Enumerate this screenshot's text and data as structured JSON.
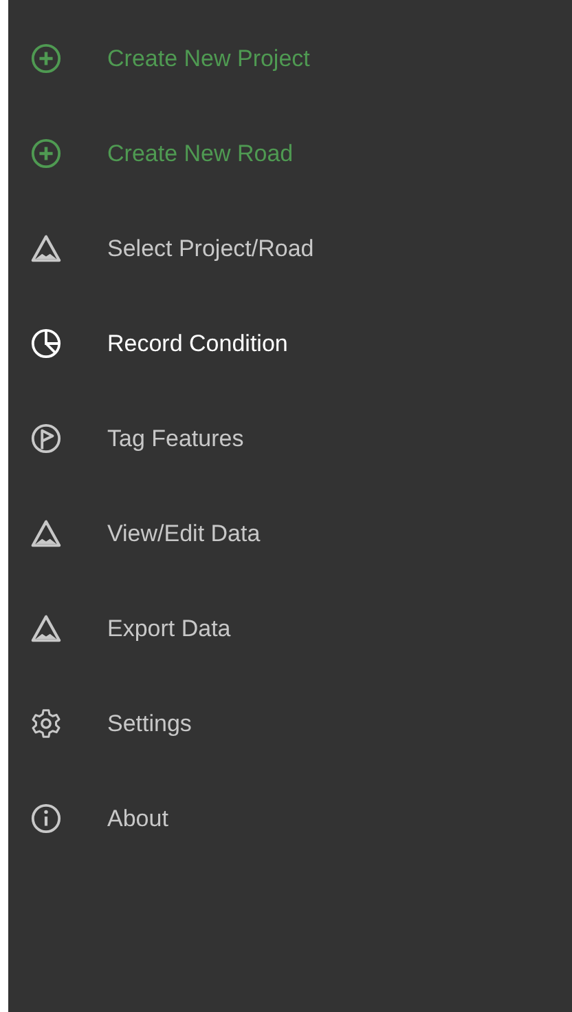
{
  "menu": {
    "items": [
      {
        "label": "Create New Project",
        "kind": "create",
        "selected": false
      },
      {
        "label": "Create New Road",
        "kind": "create",
        "selected": false
      },
      {
        "label": "Select Project/Road",
        "kind": "nav",
        "selected": false
      },
      {
        "label": "Record Condition",
        "kind": "nav",
        "selected": true
      },
      {
        "label": "Tag Features",
        "kind": "nav",
        "selected": false
      },
      {
        "label": "View/Edit Data",
        "kind": "nav",
        "selected": false
      },
      {
        "label": "Export Data",
        "kind": "nav",
        "selected": false
      },
      {
        "label": "Settings",
        "kind": "nav",
        "selected": false
      },
      {
        "label": "About",
        "kind": "nav",
        "selected": false
      }
    ]
  }
}
